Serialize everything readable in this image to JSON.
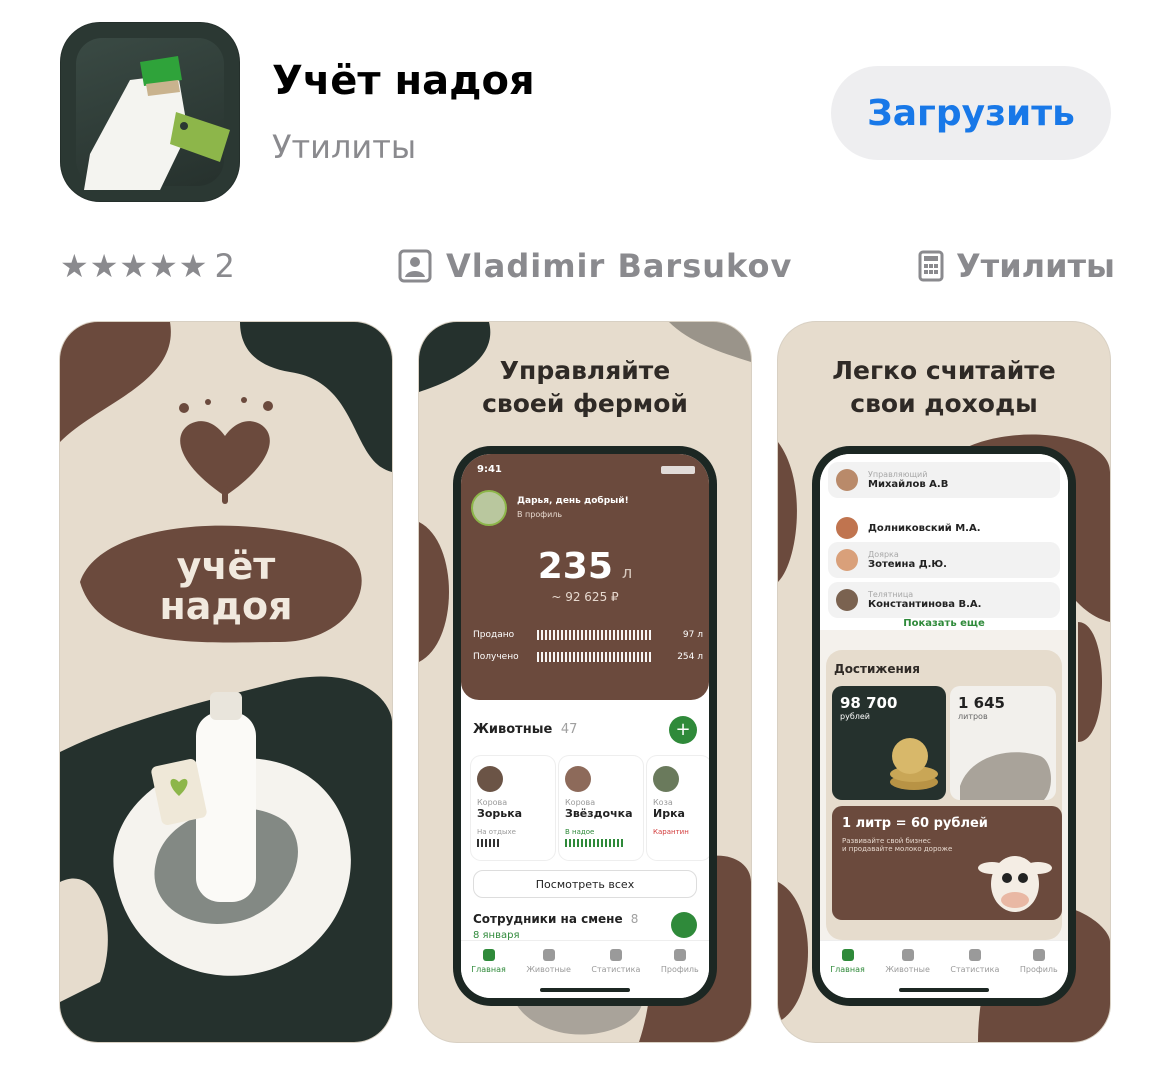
{
  "app": {
    "title": "Учёт надоя",
    "category": "Утилиты",
    "get_label": "Загрузить"
  },
  "meta": {
    "rating_stars": "★★★★★",
    "rating_count": "2",
    "developer": "Vladimir Barsukov",
    "category": "Утилиты"
  },
  "colors": {
    "accent": "#1878e8",
    "cream": "#e6dccd",
    "brown": "#6b4a3d",
    "dark": "#25312d",
    "green": "#2f8a3a"
  },
  "shot1": {
    "logo_line1": "учёт",
    "logo_line2": "надоя"
  },
  "shot2": {
    "headline_line1": "Управляйте",
    "headline_line2": "своей фермой",
    "time": "9:41",
    "greeting": "Дарья, день добрый!",
    "profile_link": "В профиль",
    "total_value": "235",
    "total_unit": "л",
    "total_money": "~ 92 625 ₽",
    "sold_label": "Продано",
    "sold_value": "97 л",
    "received_label": "Получено",
    "received_value": "254 л",
    "animals_title": "Животные",
    "animals_count": "47",
    "animals": [
      {
        "kind": "Корова",
        "name": "Зорька",
        "status": "На отдыхе"
      },
      {
        "kind": "Корова",
        "name": "Звёздочка",
        "status": "В надое"
      },
      {
        "kind": "Коза",
        "name": "Ирка",
        "status": "Карантин"
      }
    ],
    "view_all": "Посмотреть всех",
    "staff_title": "Сотрудники на смене",
    "staff_count": "8",
    "staff_date": "8 января"
  },
  "shot3": {
    "headline_line1": "Легко считайте",
    "headline_line2": "свои доходы",
    "staff": [
      {
        "role": "Управляющий",
        "name": "Михайлов А.В"
      },
      {
        "role": "",
        "name": "Долниковский М.А."
      },
      {
        "role": "Доярка",
        "name": "Зотеина Д.Ю."
      },
      {
        "role": "Телятница",
        "name": "Константинова В.А."
      }
    ],
    "show_more": "Показать еще",
    "achievements_title": "Достижения",
    "ach1_value": "98 700",
    "ach1_unit": "рублей",
    "ach2_value": "1 645",
    "ach2_unit": "литров",
    "promo_title": "1 литр = 60 рублей",
    "promo_line1": "Развивайте свой бизнес",
    "promo_line2": "и продавайте молоко дороже"
  },
  "tabs": [
    "Главная",
    "Животные",
    "Статистика",
    "Профиль"
  ]
}
